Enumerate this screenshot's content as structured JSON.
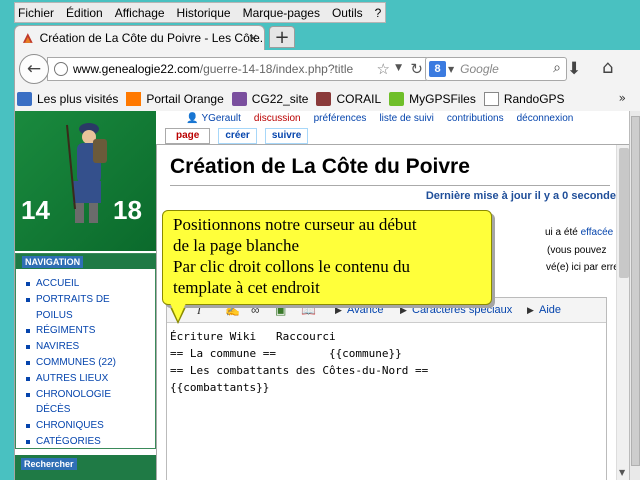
{
  "menubar": {
    "items": [
      "Fichier",
      "Édition",
      "Affichage",
      "Historique",
      "Marque-pages",
      "Outils",
      "?"
    ]
  },
  "tab": {
    "title": "Création de La Côte du Poivre - Les Côte...",
    "close": "×",
    "new_tab": "+"
  },
  "navbar": {
    "url_host": "www.genealogie22.com",
    "url_path": "/guerre-14-18/index.php?title",
    "search_placeholder": "Google",
    "google_glyph": "8"
  },
  "bookmarks": {
    "items": [
      "Les plus visités",
      "Portail Orange",
      "CG22_site",
      "CORAIL",
      "MyGPSFiles",
      "RandoGPS"
    ],
    "more": "»"
  },
  "logo": {
    "left": "14",
    "right": "18"
  },
  "sidebar": {
    "nav_heading": "NAVIGATION",
    "nav_items": [
      "ACCUEIL",
      "PORTRAITS DE",
      "POILUS",
      "RÉGIMENTS",
      "NAVIRES",
      "COMMUNES (22)",
      "AUTRES LIEUX",
      "CHRONOLOGIE",
      "DÉCÈS",
      "CHRONIQUES",
      "CATÉGORIES"
    ],
    "search_heading": "Rechercher"
  },
  "userbar": {
    "user": "YGerault",
    "discussion": "discussion",
    "preferences": "préférences",
    "watchlist": "liste de suivi",
    "contributions": "contributions",
    "logout": "déconnexion"
  },
  "page_tabs": {
    "page": "page",
    "create": "créer",
    "follow": "suivre"
  },
  "main": {
    "title": "Création de La Côte du Poivre",
    "last_update": "Dernière mise à jour il y a 0 seconde",
    "notice_1a": "ui a été",
    "notice_1b": "effacée",
    "notice_2": "(vous pouvez",
    "notice_3": "vé(e) ici par erreur,"
  },
  "editor": {
    "toolbar_advanced": "Avancé",
    "toolbar_special": "Caractères spéciaux",
    "toolbar_help": "Aide",
    "lines": [
      "Écriture Wiki   Raccourci",
      "== La commune ==        {{commune}}",
      "== Les combattants des Côtes-du-Nord ==",
      "{{combattants}}"
    ]
  },
  "callout": {
    "lines": [
      "Positionnons notre curseur au début",
      "de la page blanche",
      "Par clic droit collons le contenu du",
      "template à cet endroit"
    ]
  },
  "colors": {
    "background": "#49c1c1",
    "callout": "#ffff3a",
    "link": "#0645ad",
    "sidebar_green": "#1f7a45"
  }
}
